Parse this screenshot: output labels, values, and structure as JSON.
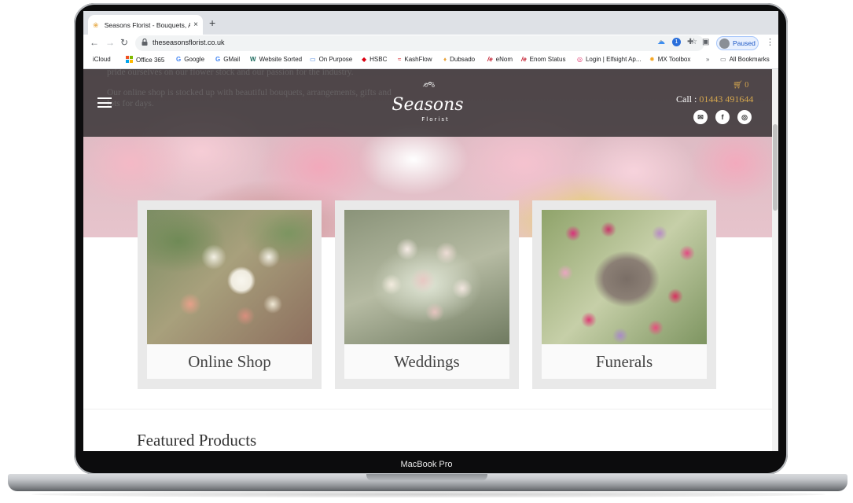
{
  "device": {
    "label": "MacBook Pro"
  },
  "browser": {
    "tab": {
      "title": "Seasons Florist - Bouquets, A",
      "close": "×"
    },
    "new_tab": "+",
    "url": "theseasonsflorist.co.uk",
    "profile": {
      "status": "Paused"
    },
    "bookmarks": [
      {
        "icon": "apple-icon",
        "label": "iCloud"
      },
      {
        "icon": "office-icon",
        "label": "Office 365"
      },
      {
        "icon": "google-icon",
        "label": "Google"
      },
      {
        "icon": "google-icon",
        "label": "GMail"
      },
      {
        "icon": "website-sorted-icon",
        "label": "Website Sorted"
      },
      {
        "icon": "link-icon",
        "label": "On Purpose"
      },
      {
        "icon": "hsbc-icon",
        "label": "HSBC"
      },
      {
        "icon": "kashflow-icon",
        "label": "KashFlow"
      },
      {
        "icon": "dubsado-icon",
        "label": "Dubsado"
      },
      {
        "icon": "enom-icon",
        "label": "eNom"
      },
      {
        "icon": "enom-icon",
        "label": "Enom Status"
      },
      {
        "icon": "elfsight-icon",
        "label": "Login | Elfsight Ap..."
      },
      {
        "icon": "mxtoolbox-icon",
        "label": "MX Toolbox"
      }
    ],
    "more_bookmarks": "»",
    "all_bookmarks": "All Bookmarks"
  },
  "site": {
    "ghost_lines": [
      "pride ourselves on our flower stock and our passion for the industry.",
      "Our online shop is stocked up with beautiful bouquets, arrangements, gifts and",
      "lots for days."
    ],
    "logo_text": "Seasons",
    "logo_sub": "Florist",
    "cart_count": "0",
    "call_prefix": "Call : ",
    "phone": "01443 491644",
    "cards": [
      {
        "label": "Online Shop"
      },
      {
        "label": "Weddings"
      },
      {
        "label": "Funerals"
      }
    ],
    "featured_title": "Featured Products"
  },
  "colors": {
    "accent": "#d4a64e",
    "header": "#282628",
    "card_bg": "#e9e9e9"
  }
}
